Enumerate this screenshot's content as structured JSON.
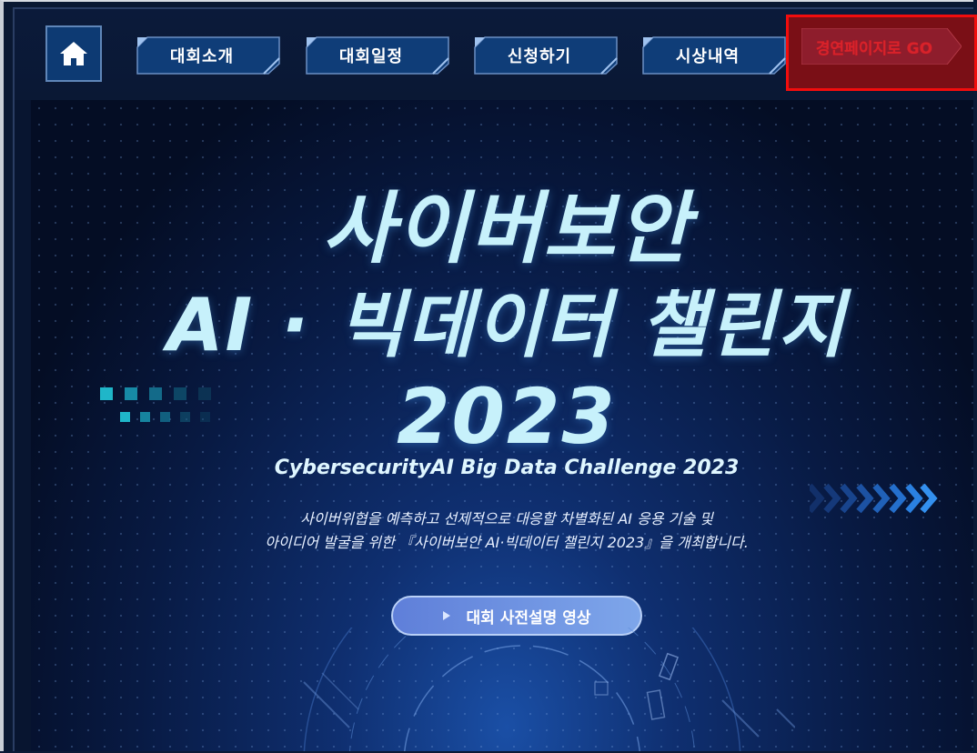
{
  "nav": {
    "home_icon": "home-icon",
    "items": [
      {
        "label": "대회소개"
      },
      {
        "label": "대회일정"
      },
      {
        "label": "신청하기"
      },
      {
        "label": "시상내역"
      }
    ],
    "go_label": "경연페이지로 GO"
  },
  "hero": {
    "title_line1": "사이버보안",
    "title_line2": "AI · 빅데이터 챌린지",
    "title_line3": "2023",
    "subtitle_en": "CybersecurityAI Big Data Challenge 2023",
    "desc_line1": "사이버위협을 예측하고 선제적으로 대응할 차별화된 AI 응용 기술 및",
    "desc_line2": "아이디어 발굴을 위한 『사이버보안 AI·빅데이터 챌린지 2023』을 개최합니다.",
    "video_button": "대회 사전설명 영상"
  },
  "colors": {
    "nav_button": "#0f3d78",
    "title": "#c7f1fb",
    "highlight": "#f20d0d",
    "accent_cyan": "#1fb6c9"
  }
}
